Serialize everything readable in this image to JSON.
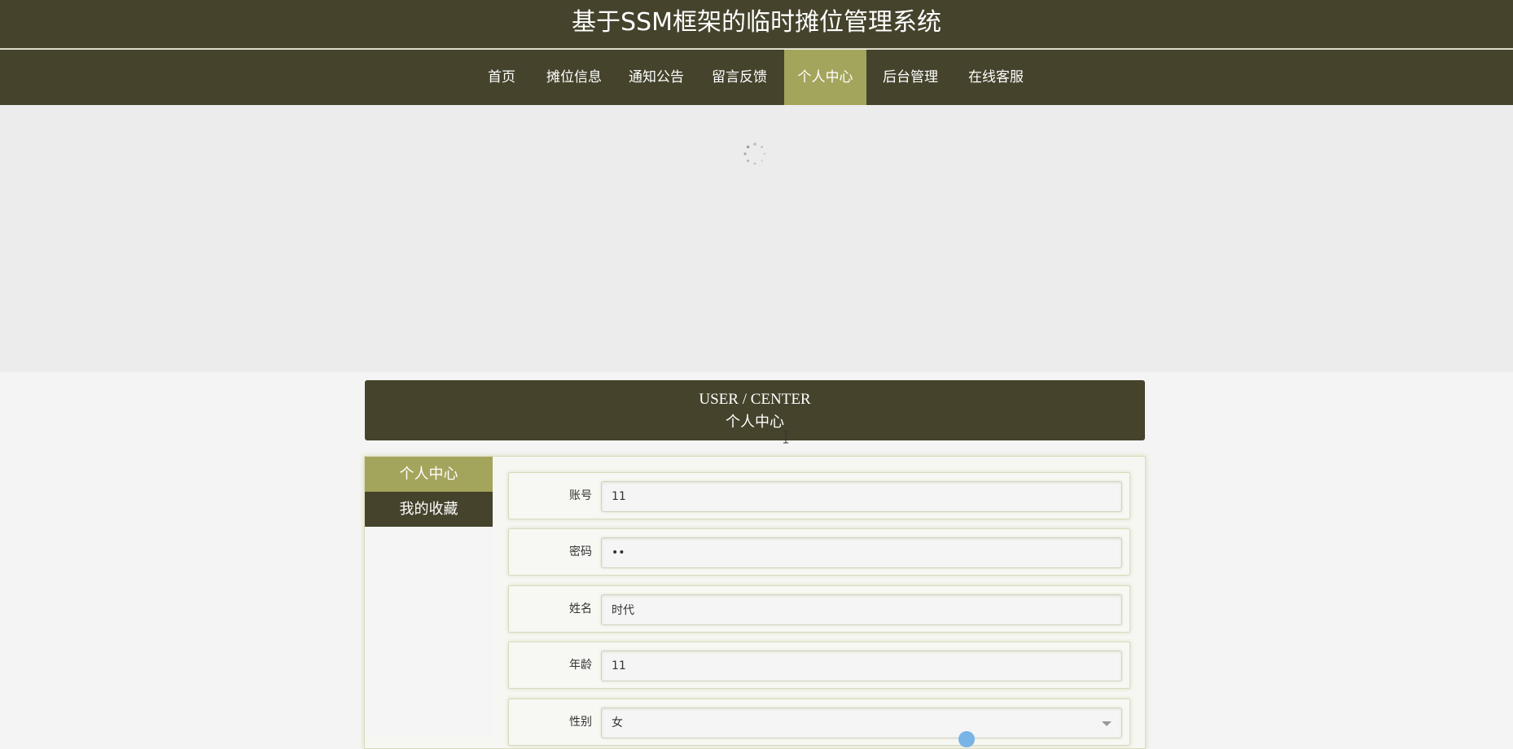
{
  "header": {
    "site_title": "基于SSM框架的临时摊位管理系统"
  },
  "nav": {
    "items": [
      {
        "label": "首页"
      },
      {
        "label": "摊位信息"
      },
      {
        "label": "通知公告"
      },
      {
        "label": "留言反馈"
      },
      {
        "label": "个人中心",
        "active": true
      },
      {
        "label": "后台管理"
      },
      {
        "label": "在线客服"
      }
    ]
  },
  "center": {
    "title_en": "USER / CENTER",
    "title_cn": "个人中心"
  },
  "side_menu": {
    "items": [
      {
        "label": "个人中心",
        "active": true
      },
      {
        "label": "我的收藏"
      }
    ]
  },
  "form": {
    "account": {
      "label": "账号",
      "value": "11"
    },
    "password": {
      "label": "密码",
      "value": "11"
    },
    "name": {
      "label": "姓名",
      "value": "时代"
    },
    "age": {
      "label": "年龄",
      "value": "11"
    },
    "gender": {
      "label": "性别",
      "value": "女"
    }
  },
  "colors": {
    "header_bg": "#45432c",
    "accent": "#a4a55c",
    "page_bg": "#f4f4f4"
  },
  "icons": {
    "loading": "loading-spinner-icon",
    "dropdown": "chevron-down-icon"
  }
}
